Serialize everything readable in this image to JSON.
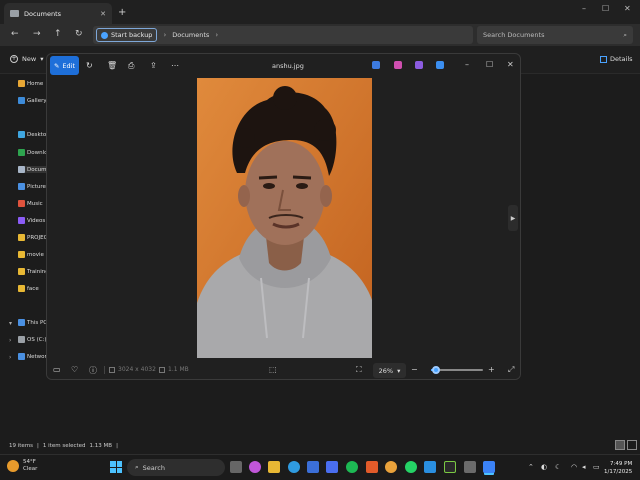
{
  "explorer": {
    "tab_label": "Documents",
    "tab_close": "✕",
    "new_tab": "+",
    "nav": {
      "back": "←",
      "forward": "→",
      "up": "↑",
      "refresh": "↻"
    },
    "breadcrumb": {
      "backup_label": "Start backup",
      "folder": "Documents"
    },
    "search_placeholder": "Search Documents",
    "new_label": "New",
    "details_label": "Details",
    "sidebar": [
      {
        "label": "Home",
        "color": "#e8a735"
      },
      {
        "label": "Gallery",
        "color": "#3d8bd9"
      },
      {
        "label": "Desktop",
        "color": "#3fa6e0"
      },
      {
        "label": "Downloads",
        "color": "#2ea44f"
      },
      {
        "label": "Documents",
        "color": "#a8b6c8"
      },
      {
        "label": "Pictures",
        "color": "#4a90e2"
      },
      {
        "label": "Music",
        "color": "#e0533d"
      },
      {
        "label": "Videos",
        "color": "#8b5cf6"
      },
      {
        "label": "PROJECTS",
        "color": "#e8b834"
      },
      {
        "label": "movie reviews",
        "color": "#e8b834"
      },
      {
        "label": "Training_Data",
        "color": "#e8b834"
      },
      {
        "label": "face",
        "color": "#e8b834"
      },
      {
        "label": "This PC",
        "color": "#4a90e2"
      },
      {
        "label": "OS (C:)",
        "color": "#9aa0a6"
      },
      {
        "label": "Network",
        "color": "#4a90e2"
      }
    ],
    "status": {
      "items": "19 items",
      "selected": "1 item selected",
      "size": "1.13 MB"
    }
  },
  "photos": {
    "edit_label": "Edit",
    "filename": "anshu.jpg",
    "dimensions": "3024 x 4032",
    "filesize": "1.1 MB",
    "zoom": "26%",
    "zoom_fraction": 0.1,
    "photo_colors": {
      "background": "#d4762e",
      "hoodie": "#a9a9ab",
      "skin": "#a0715a",
      "hair": "#1d1410"
    }
  },
  "taskbar": {
    "temperature": "54°F",
    "weather": "Clear",
    "search_label": "Search",
    "time": "7:49 PM",
    "date": "1/17/2025"
  }
}
